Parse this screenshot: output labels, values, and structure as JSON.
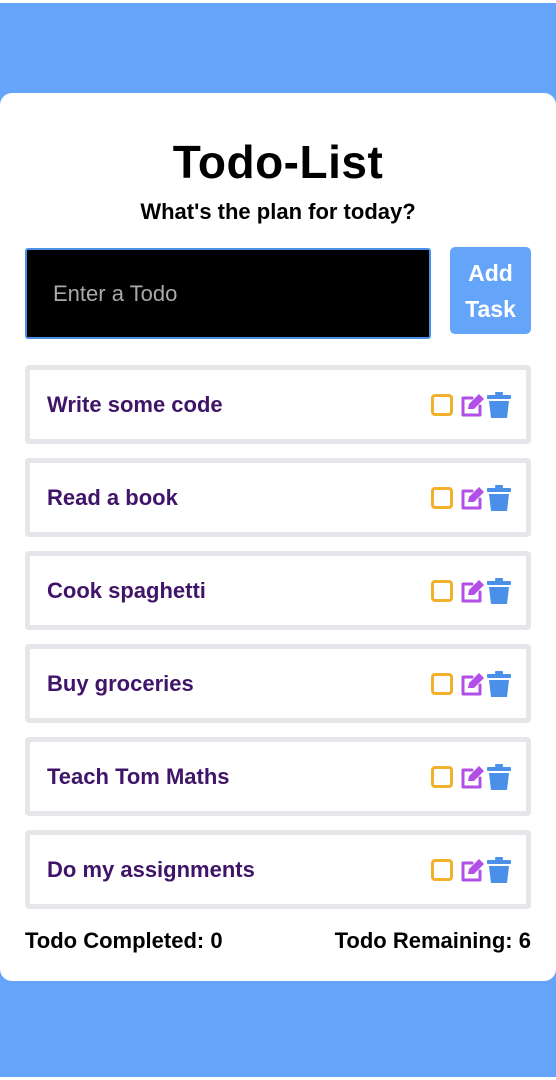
{
  "header": {
    "title": "Todo-List",
    "subtitle": "What's the plan for today?"
  },
  "input": {
    "placeholder": "Enter a Todo",
    "value": ""
  },
  "add_button": {
    "label": "Add Task"
  },
  "todos": [
    {
      "text": "Write some code",
      "completed": false
    },
    {
      "text": "Read a book",
      "completed": false
    },
    {
      "text": "Cook spaghetti",
      "completed": false
    },
    {
      "text": "Buy groceries",
      "completed": false
    },
    {
      "text": "Teach Tom Maths",
      "completed": false
    },
    {
      "text": "Do my assignments",
      "completed": false
    }
  ],
  "item_icons": [
    "checkbox-icon",
    "edit-icon",
    "trash-icon"
  ],
  "footer": {
    "completed_label": "Todo Completed:",
    "completed_count": "0",
    "remaining_label": "Todo Remaining:",
    "remaining_count": "6"
  },
  "colors": {
    "background": "#64a5fa",
    "card": "#ffffff",
    "accent_button": "#64a5fa",
    "todo_text": "#3f1469",
    "checkbox": "#f2b12b",
    "edit_icon": "#b14fe6",
    "delete_icon": "#4a8fe8",
    "item_border": "#e5e6ea"
  }
}
